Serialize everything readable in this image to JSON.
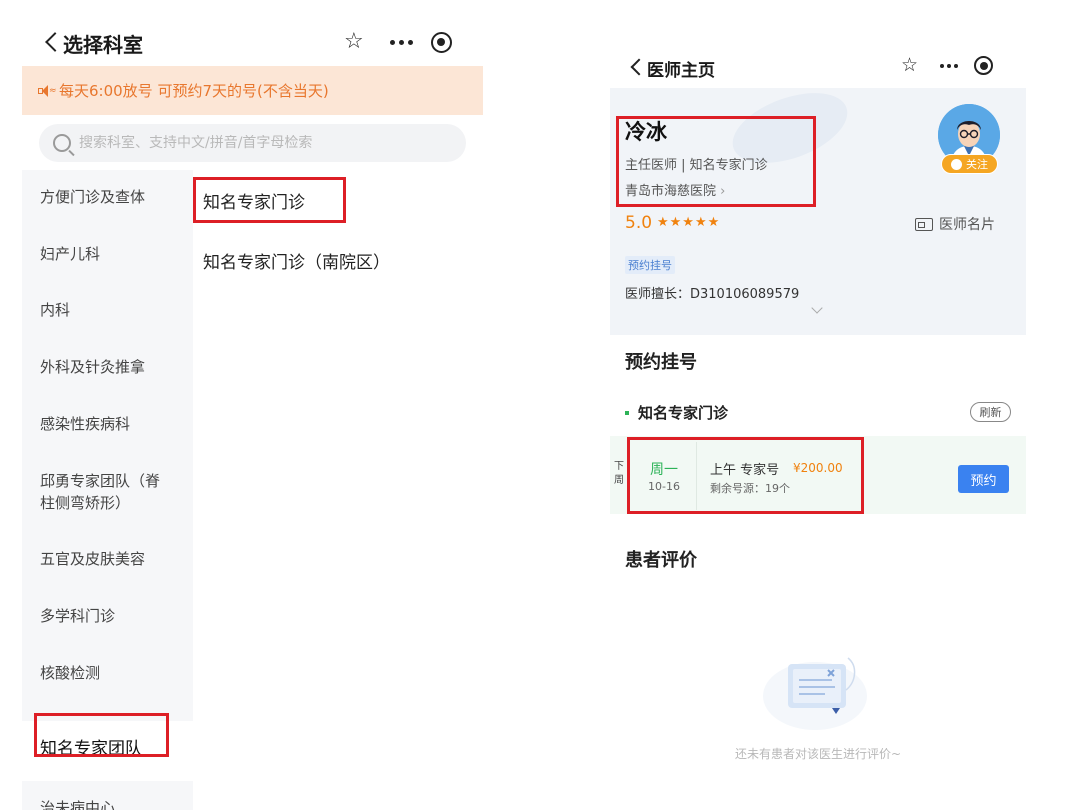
{
  "left_screen": {
    "title": "选择科室",
    "notice": "每天6:00放号  可预约7天的号(不含当天)",
    "search_placeholder": "搜索科室、支持中文/拼音/首字母检索",
    "departments": [
      {
        "label": "方便门诊及查体"
      },
      {
        "label": "妇产儿科"
      },
      {
        "label": "内科"
      },
      {
        "label": "外科及针灸推拿"
      },
      {
        "label": "感染性疾病科"
      },
      {
        "label": "邱勇专家团队（脊柱侧弯矫形）"
      },
      {
        "label": "五官及皮肤美容"
      },
      {
        "label": "多学科门诊"
      },
      {
        "label": "核酸检测"
      },
      {
        "label": "知名专家团队"
      },
      {
        "label": "治未病中心"
      }
    ],
    "active_department": "知名专家团队",
    "sub_departments": [
      {
        "label": "知名专家门诊"
      },
      {
        "label": "知名专家门诊（南院区）"
      }
    ]
  },
  "right_screen": {
    "title": "医师主页",
    "doctor": {
      "name": "冷冰",
      "title_line": "主任医师 | 知名专家门诊",
      "hospital": "青岛市海慈医院",
      "rating": "5.0",
      "stars": 5,
      "follow_label": "关注",
      "card_label": "医师名片",
      "tag": "预约挂号",
      "skill": "医师擅长：D310106089579"
    },
    "appointment": {
      "section_title": "预约挂号",
      "department": "知名专家门诊",
      "refresh_label": "刷新",
      "slot": {
        "week_label": "下周",
        "weekday": "周一",
        "date": "10-16",
        "type": "上午  专家号",
        "price": "¥200.00",
        "remaining": "剩余号源：19个",
        "book_label": "预约"
      }
    },
    "reviews": {
      "section_title": "患者评价",
      "empty_text": "还未有患者对该医生进行评价~"
    }
  },
  "colors": {
    "highlight_box": "#dd1f26",
    "accent_orange": "#f0820f",
    "accent_green": "#2db358",
    "button_blue": "#3a82f0",
    "notice_bg": "#fce6d6"
  }
}
